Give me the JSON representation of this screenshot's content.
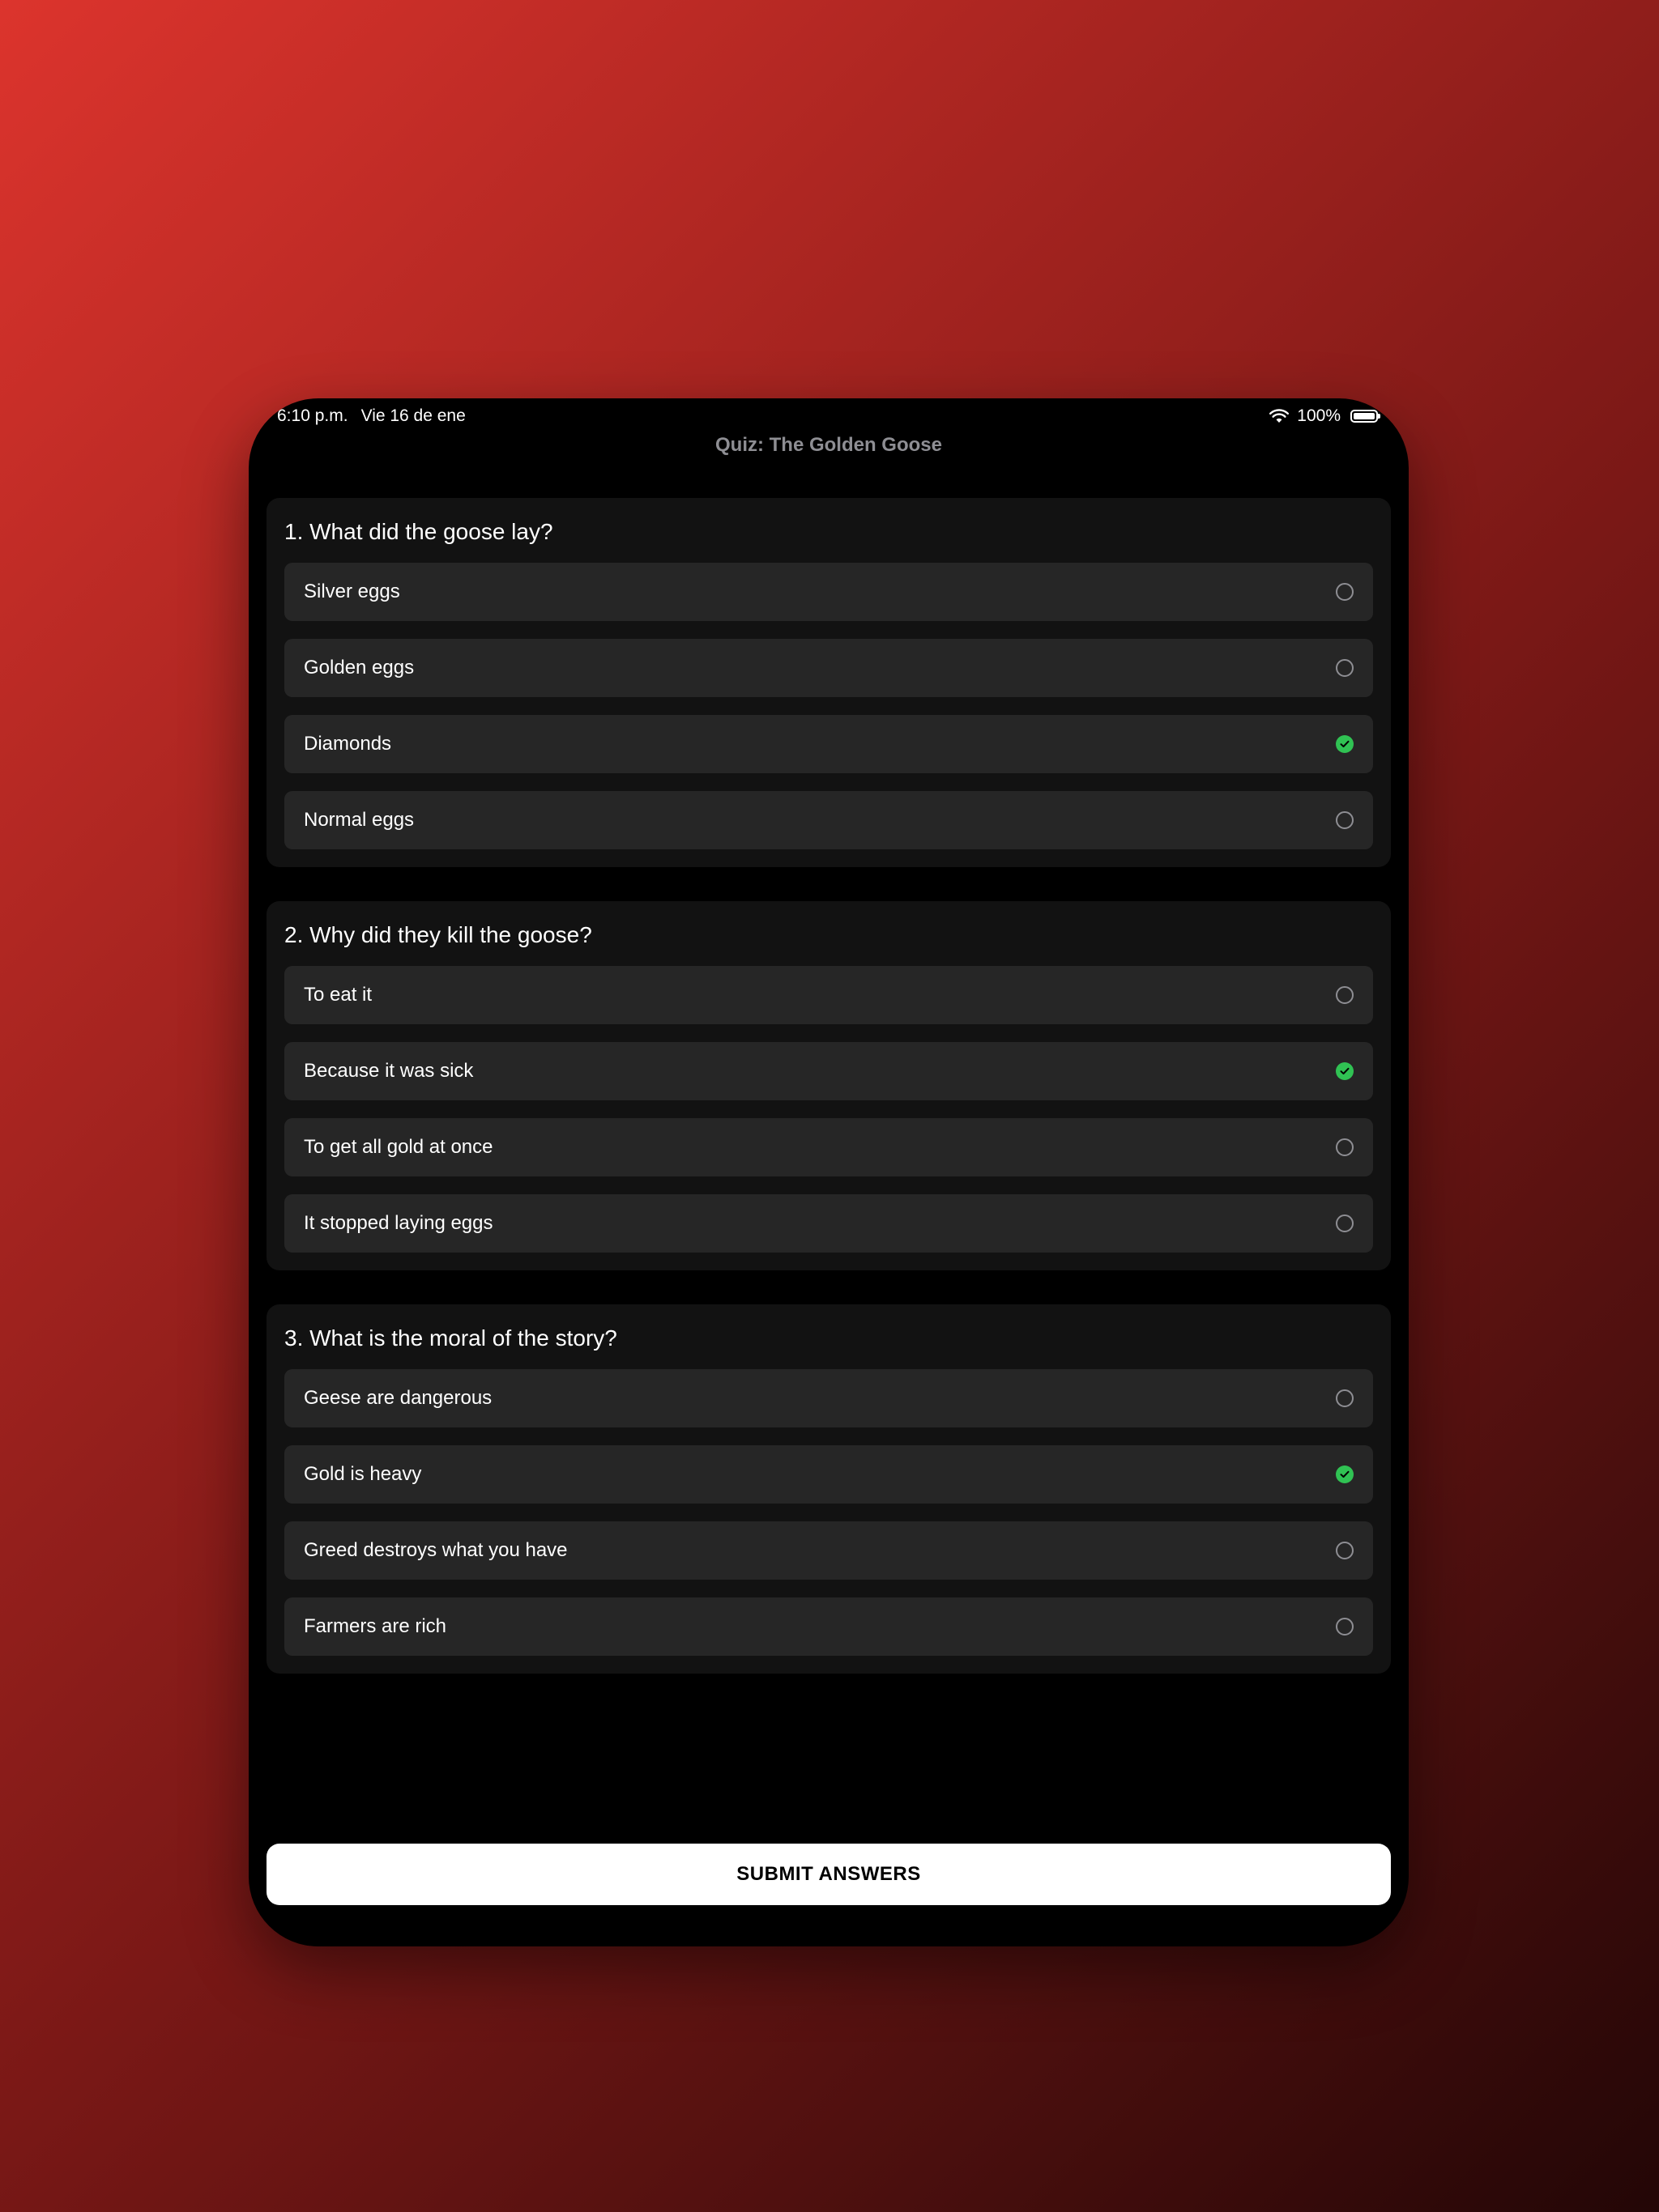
{
  "status_bar": {
    "time": "6:10 p.m.",
    "date": "Vie 16 de ene",
    "battery": "100%",
    "wifi_icon": "wifi-icon",
    "battery_icon": "battery-icon"
  },
  "nav": {
    "title": "Quiz: The Golden Goose"
  },
  "colors": {
    "accent_selected": "#30c253",
    "card_bg": "#121212",
    "option_bg": "#262626"
  },
  "questions": [
    {
      "title": "1. What did the goose lay?",
      "options": [
        {
          "label": "Silver eggs",
          "selected": false
        },
        {
          "label": "Golden eggs",
          "selected": false
        },
        {
          "label": "Diamonds",
          "selected": true
        },
        {
          "label": "Normal eggs",
          "selected": false
        }
      ]
    },
    {
      "title": "2. Why did they kill the goose?",
      "options": [
        {
          "label": "To eat it",
          "selected": false
        },
        {
          "label": "Because it was sick",
          "selected": true
        },
        {
          "label": "To get all gold at once",
          "selected": false
        },
        {
          "label": "It stopped laying eggs",
          "selected": false
        }
      ]
    },
    {
      "title": "3. What is the moral of the story?",
      "options": [
        {
          "label": "Geese are dangerous",
          "selected": false
        },
        {
          "label": "Gold is heavy",
          "selected": true
        },
        {
          "label": "Greed destroys what you have",
          "selected": false
        },
        {
          "label": "Farmers are rich",
          "selected": false
        }
      ]
    }
  ],
  "submit": {
    "label": "SUBMIT ANSWERS"
  }
}
